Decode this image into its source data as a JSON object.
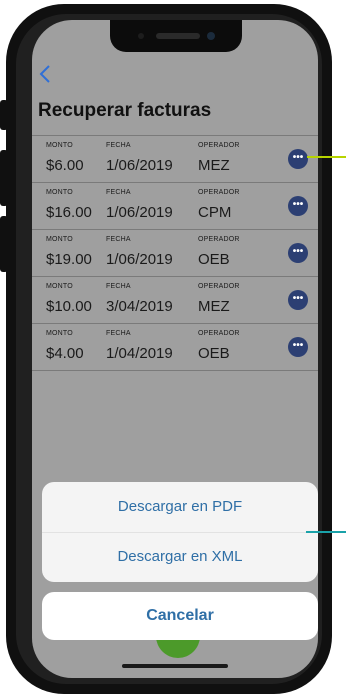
{
  "app": {
    "title": "Recuperar facturas",
    "back_icon": "chevron-left-icon"
  },
  "list": {
    "columns": [
      "MONTO",
      "FECHA",
      "OPERADOR"
    ],
    "rows": [
      {
        "monto": "$6.00",
        "fecha": "1/06/2019",
        "operador": "MEZ"
      },
      {
        "monto": "$16.00",
        "fecha": "1/06/2019",
        "operador": "CPM"
      },
      {
        "monto": "$19.00",
        "fecha": "1/06/2019",
        "operador": "OEB"
      },
      {
        "monto": "$10.00",
        "fecha": "3/04/2019",
        "operador": "MEZ"
      },
      {
        "monto": "$4.00",
        "fecha": "1/04/2019",
        "operador": "OEB"
      }
    ],
    "row_action_icon": "more-options-icon"
  },
  "action_sheet": {
    "option_pdf": "Descargar en PDF",
    "option_xml": "Descargar en XML",
    "cancel": "Cancelar"
  },
  "colors": {
    "accent": "#2f6fa6",
    "row_action": "#2c3f73",
    "fab": "#4c9a2a",
    "callout_top": "#b7d400",
    "callout_bottom": "#1aa2a9"
  }
}
